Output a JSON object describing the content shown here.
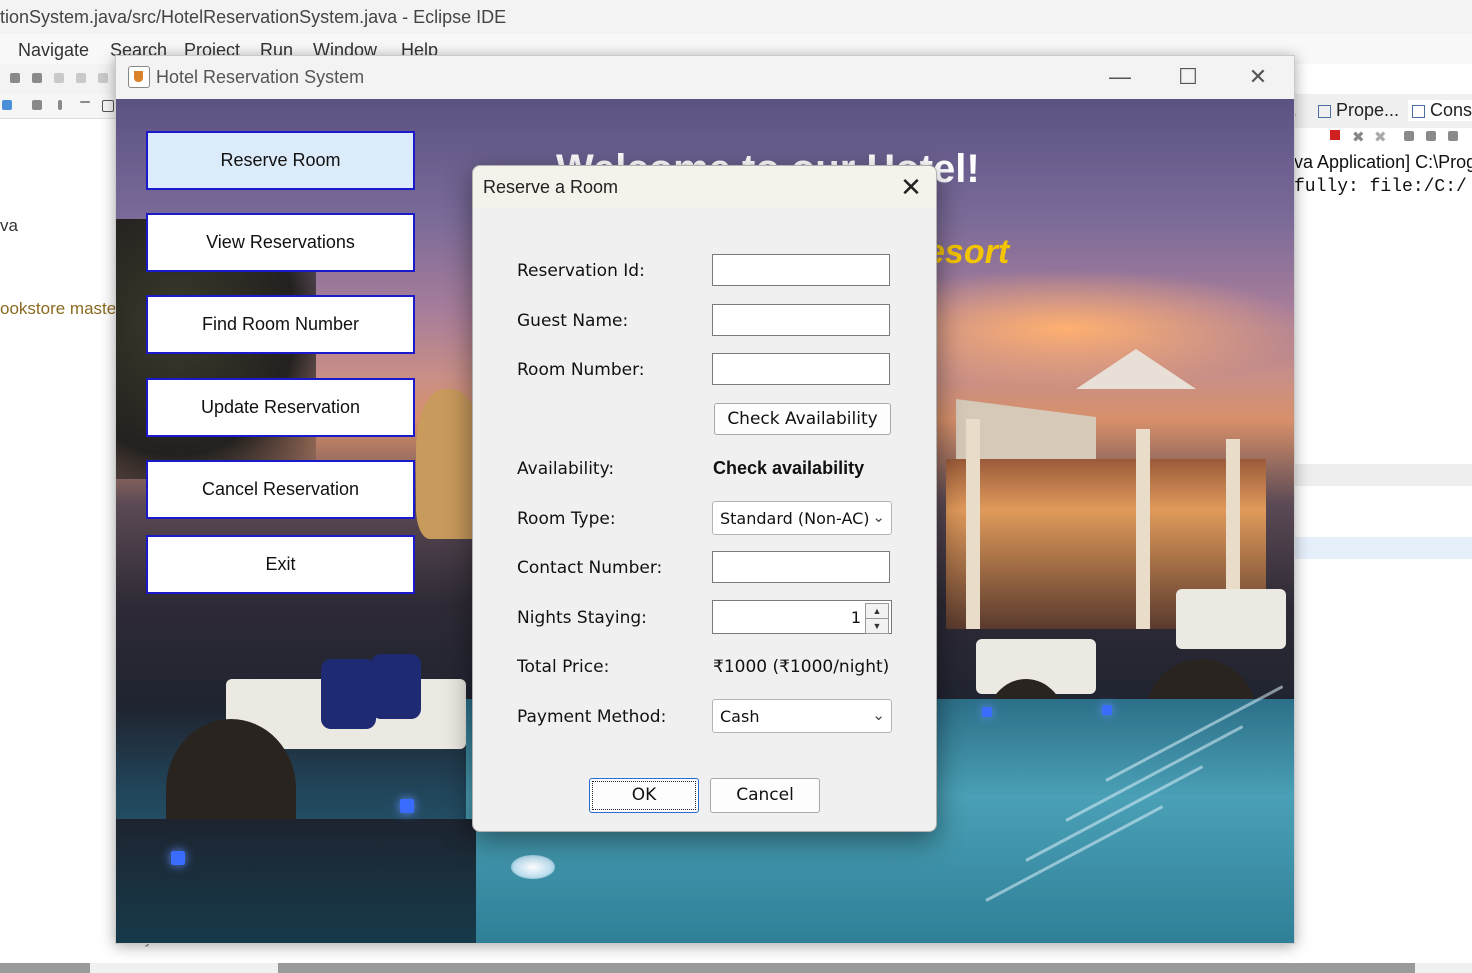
{
  "ide": {
    "title": "tionSystem.java/src/HotelReservationSystem.java - Eclipse IDE",
    "menu": [
      "Navigate",
      "Search",
      "Project",
      "Run",
      "Window",
      "Help"
    ],
    "left_texts": [
      "va",
      "ookstore maste"
    ],
    "right_tabs": [
      "Prope...",
      "Cons."
    ],
    "console_lines": [
      "va Application] C:\\Progr",
      "fully: file:/C:/"
    ],
    "bottom_text": "}"
  },
  "window": {
    "title": "Hotel Reservation System",
    "controls": [
      "minimize",
      "maximize",
      "close"
    ]
  },
  "banner": {
    "welcome": "Welcome to our Hotel!",
    "resort": "esort"
  },
  "menu": {
    "buttons": [
      "Reserve Room",
      "View Reservations",
      "Find Room Number",
      "Update Reservation",
      "Cancel Reservation",
      "Exit"
    ]
  },
  "dialog": {
    "title": "Reserve a Room",
    "close_glyph": "✕",
    "labels": {
      "reservation_id": "Reservation Id:",
      "guest_name": "Guest Name:",
      "room_number": "Room Number:",
      "availability": "Availability:",
      "room_type": "Room Type:",
      "contact_number": "Contact Number:",
      "nights_staying": "Nights Staying:",
      "total_price": "Total Price:",
      "payment_method": "Payment Method:"
    },
    "values": {
      "reservation_id": "",
      "guest_name": "",
      "room_number": "",
      "availability": "Check availability",
      "room_type": "Standard (Non-AC)",
      "contact_number": "",
      "nights_staying": "1",
      "total_price": "₹1000 (₹1000/night)",
      "payment_method": "Cash"
    },
    "check_button": "Check Availability",
    "ok_button": "OK",
    "cancel_button": "Cancel"
  },
  "colors": {
    "menu_button_border": "#1a1acc",
    "active_button_bg": "#dcebfa",
    "resort_text": "#f3c400"
  }
}
